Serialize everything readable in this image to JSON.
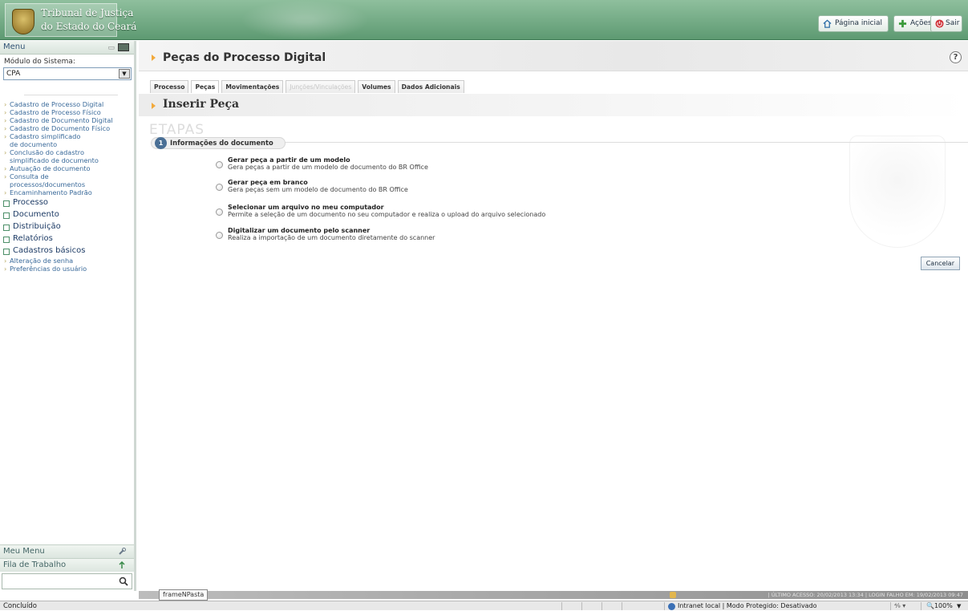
{
  "header": {
    "logo_line1": "Tribunal de Justiça",
    "logo_line2": "do Estado do Ceará",
    "home_label": "Página inicial",
    "actions_label": "Ações",
    "exit_label": "Sair",
    "colors": {
      "header_green": "#5e9a72",
      "accent_orange": "#f2a93b",
      "link_blue": "#3a6a9a"
    }
  },
  "sidebar": {
    "menu_label": "Menu",
    "modulo_label": "Módulo do Sistema:",
    "modulo_value": "CPA",
    "sub_items": [
      "Cadastro de Processo Digital",
      "Cadastro de Processo Físico",
      "Cadastro de Documento Digital",
      "Cadastro de Documento Físico",
      "Cadastro simplificado de documento",
      "Conclusão do cadastro simplificado de documento",
      "Autuação de documento",
      "Consulta de processos/documentos",
      "Encaminhamento Padrão"
    ],
    "sections": [
      "Processo",
      "Documento",
      "Distribuição",
      "Relatórios",
      "Cadastros básicos"
    ],
    "extra_items": [
      "Alteração de senha",
      "Preferências do usuário"
    ],
    "meu_menu": "Meu Menu",
    "fila": "Fila de Trabalho",
    "search_placeholder": ""
  },
  "main": {
    "page_title": "Peças do Processo Digital",
    "help": "?",
    "tabs": [
      "Processo",
      "Peças",
      "Movimentações",
      "Junções/Vinculações",
      "Volumes",
      "Dados Adicionais"
    ],
    "section_title": "Inserir Peça",
    "etapas": "ETAPAS",
    "step_number": "1",
    "step_label": "Informações do documento",
    "options": [
      {
        "title": "Gerar peça a partir de um modelo",
        "desc": "Gera peças a partir de um modelo de documento do BR Office"
      },
      {
        "title": "Gerar peça em branco",
        "desc": "Gera peças sem um modelo de documento do BR Office"
      },
      {
        "title": "Selecionar um arquivo no meu computador",
        "desc": "Permite a seleção de um documento no seu computador e realiza o upload do arquivo selecionado"
      },
      {
        "title": "Digitalizar um documento pelo scanner",
        "desc": "Realiza a importação de um documento diretamente do scanner"
      }
    ],
    "cancel_label": "Cancelar"
  },
  "app_status": {
    "text": "|  ÚLTIMO ACESSO: 20/02/2013 13:34  |  LOGIN FALHO EM: 19/02/2013 09:47",
    "frame_label": "frameNPasta"
  },
  "browser_status": {
    "left": "Concluído",
    "zone": "Intranet local | Modo Protegido: Desativado",
    "zoom": "100%",
    "misc": "⁴⁄₉ ▾"
  }
}
